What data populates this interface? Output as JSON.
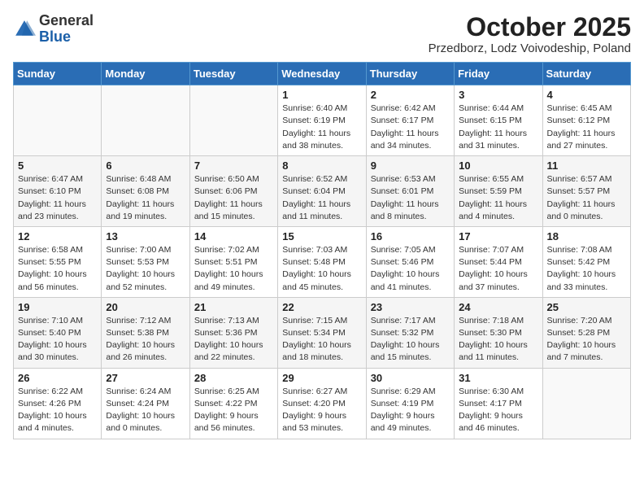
{
  "header": {
    "logo_general": "General",
    "logo_blue": "Blue",
    "month": "October 2025",
    "location": "Przedborz, Lodz Voivodeship, Poland"
  },
  "weekdays": [
    "Sunday",
    "Monday",
    "Tuesday",
    "Wednesday",
    "Thursday",
    "Friday",
    "Saturday"
  ],
  "weeks": [
    [
      {
        "day": "",
        "info": ""
      },
      {
        "day": "",
        "info": ""
      },
      {
        "day": "",
        "info": ""
      },
      {
        "day": "1",
        "info": "Sunrise: 6:40 AM\nSunset: 6:19 PM\nDaylight: 11 hours\nand 38 minutes."
      },
      {
        "day": "2",
        "info": "Sunrise: 6:42 AM\nSunset: 6:17 PM\nDaylight: 11 hours\nand 34 minutes."
      },
      {
        "day": "3",
        "info": "Sunrise: 6:44 AM\nSunset: 6:15 PM\nDaylight: 11 hours\nand 31 minutes."
      },
      {
        "day": "4",
        "info": "Sunrise: 6:45 AM\nSunset: 6:12 PM\nDaylight: 11 hours\nand 27 minutes."
      }
    ],
    [
      {
        "day": "5",
        "info": "Sunrise: 6:47 AM\nSunset: 6:10 PM\nDaylight: 11 hours\nand 23 minutes."
      },
      {
        "day": "6",
        "info": "Sunrise: 6:48 AM\nSunset: 6:08 PM\nDaylight: 11 hours\nand 19 minutes."
      },
      {
        "day": "7",
        "info": "Sunrise: 6:50 AM\nSunset: 6:06 PM\nDaylight: 11 hours\nand 15 minutes."
      },
      {
        "day": "8",
        "info": "Sunrise: 6:52 AM\nSunset: 6:04 PM\nDaylight: 11 hours\nand 11 minutes."
      },
      {
        "day": "9",
        "info": "Sunrise: 6:53 AM\nSunset: 6:01 PM\nDaylight: 11 hours\nand 8 minutes."
      },
      {
        "day": "10",
        "info": "Sunrise: 6:55 AM\nSunset: 5:59 PM\nDaylight: 11 hours\nand 4 minutes."
      },
      {
        "day": "11",
        "info": "Sunrise: 6:57 AM\nSunset: 5:57 PM\nDaylight: 11 hours\nand 0 minutes."
      }
    ],
    [
      {
        "day": "12",
        "info": "Sunrise: 6:58 AM\nSunset: 5:55 PM\nDaylight: 10 hours\nand 56 minutes."
      },
      {
        "day": "13",
        "info": "Sunrise: 7:00 AM\nSunset: 5:53 PM\nDaylight: 10 hours\nand 52 minutes."
      },
      {
        "day": "14",
        "info": "Sunrise: 7:02 AM\nSunset: 5:51 PM\nDaylight: 10 hours\nand 49 minutes."
      },
      {
        "day": "15",
        "info": "Sunrise: 7:03 AM\nSunset: 5:48 PM\nDaylight: 10 hours\nand 45 minutes."
      },
      {
        "day": "16",
        "info": "Sunrise: 7:05 AM\nSunset: 5:46 PM\nDaylight: 10 hours\nand 41 minutes."
      },
      {
        "day": "17",
        "info": "Sunrise: 7:07 AM\nSunset: 5:44 PM\nDaylight: 10 hours\nand 37 minutes."
      },
      {
        "day": "18",
        "info": "Sunrise: 7:08 AM\nSunset: 5:42 PM\nDaylight: 10 hours\nand 33 minutes."
      }
    ],
    [
      {
        "day": "19",
        "info": "Sunrise: 7:10 AM\nSunset: 5:40 PM\nDaylight: 10 hours\nand 30 minutes."
      },
      {
        "day": "20",
        "info": "Sunrise: 7:12 AM\nSunset: 5:38 PM\nDaylight: 10 hours\nand 26 minutes."
      },
      {
        "day": "21",
        "info": "Sunrise: 7:13 AM\nSunset: 5:36 PM\nDaylight: 10 hours\nand 22 minutes."
      },
      {
        "day": "22",
        "info": "Sunrise: 7:15 AM\nSunset: 5:34 PM\nDaylight: 10 hours\nand 18 minutes."
      },
      {
        "day": "23",
        "info": "Sunrise: 7:17 AM\nSunset: 5:32 PM\nDaylight: 10 hours\nand 15 minutes."
      },
      {
        "day": "24",
        "info": "Sunrise: 7:18 AM\nSunset: 5:30 PM\nDaylight: 10 hours\nand 11 minutes."
      },
      {
        "day": "25",
        "info": "Sunrise: 7:20 AM\nSunset: 5:28 PM\nDaylight: 10 hours\nand 7 minutes."
      }
    ],
    [
      {
        "day": "26",
        "info": "Sunrise: 6:22 AM\nSunset: 4:26 PM\nDaylight: 10 hours\nand 4 minutes."
      },
      {
        "day": "27",
        "info": "Sunrise: 6:24 AM\nSunset: 4:24 PM\nDaylight: 10 hours\nand 0 minutes."
      },
      {
        "day": "28",
        "info": "Sunrise: 6:25 AM\nSunset: 4:22 PM\nDaylight: 9 hours\nand 56 minutes."
      },
      {
        "day": "29",
        "info": "Sunrise: 6:27 AM\nSunset: 4:20 PM\nDaylight: 9 hours\nand 53 minutes."
      },
      {
        "day": "30",
        "info": "Sunrise: 6:29 AM\nSunset: 4:19 PM\nDaylight: 9 hours\nand 49 minutes."
      },
      {
        "day": "31",
        "info": "Sunrise: 6:30 AM\nSunset: 4:17 PM\nDaylight: 9 hours\nand 46 minutes."
      },
      {
        "day": "",
        "info": ""
      }
    ]
  ]
}
